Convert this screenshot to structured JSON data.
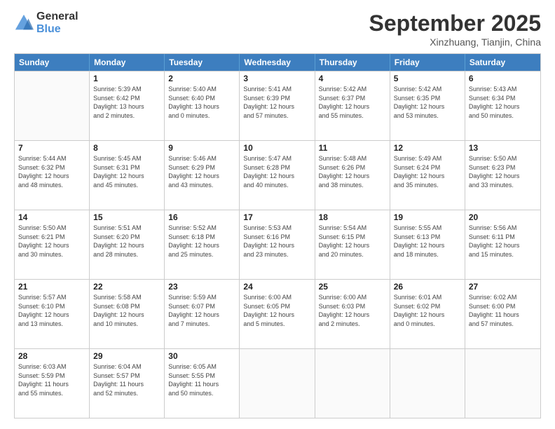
{
  "header": {
    "logo_line1": "General",
    "logo_line2": "Blue",
    "month": "September 2025",
    "location": "Xinzhuang, Tianjin, China"
  },
  "weekdays": [
    "Sunday",
    "Monday",
    "Tuesday",
    "Wednesday",
    "Thursday",
    "Friday",
    "Saturday"
  ],
  "rows": [
    [
      {
        "day": "",
        "lines": []
      },
      {
        "day": "1",
        "lines": [
          "Sunrise: 5:39 AM",
          "Sunset: 6:42 PM",
          "Daylight: 13 hours",
          "and 2 minutes."
        ]
      },
      {
        "day": "2",
        "lines": [
          "Sunrise: 5:40 AM",
          "Sunset: 6:40 PM",
          "Daylight: 13 hours",
          "and 0 minutes."
        ]
      },
      {
        "day": "3",
        "lines": [
          "Sunrise: 5:41 AM",
          "Sunset: 6:39 PM",
          "Daylight: 12 hours",
          "and 57 minutes."
        ]
      },
      {
        "day": "4",
        "lines": [
          "Sunrise: 5:42 AM",
          "Sunset: 6:37 PM",
          "Daylight: 12 hours",
          "and 55 minutes."
        ]
      },
      {
        "day": "5",
        "lines": [
          "Sunrise: 5:42 AM",
          "Sunset: 6:35 PM",
          "Daylight: 12 hours",
          "and 53 minutes."
        ]
      },
      {
        "day": "6",
        "lines": [
          "Sunrise: 5:43 AM",
          "Sunset: 6:34 PM",
          "Daylight: 12 hours",
          "and 50 minutes."
        ]
      }
    ],
    [
      {
        "day": "7",
        "lines": [
          "Sunrise: 5:44 AM",
          "Sunset: 6:32 PM",
          "Daylight: 12 hours",
          "and 48 minutes."
        ]
      },
      {
        "day": "8",
        "lines": [
          "Sunrise: 5:45 AM",
          "Sunset: 6:31 PM",
          "Daylight: 12 hours",
          "and 45 minutes."
        ]
      },
      {
        "day": "9",
        "lines": [
          "Sunrise: 5:46 AM",
          "Sunset: 6:29 PM",
          "Daylight: 12 hours",
          "and 43 minutes."
        ]
      },
      {
        "day": "10",
        "lines": [
          "Sunrise: 5:47 AM",
          "Sunset: 6:28 PM",
          "Daylight: 12 hours",
          "and 40 minutes."
        ]
      },
      {
        "day": "11",
        "lines": [
          "Sunrise: 5:48 AM",
          "Sunset: 6:26 PM",
          "Daylight: 12 hours",
          "and 38 minutes."
        ]
      },
      {
        "day": "12",
        "lines": [
          "Sunrise: 5:49 AM",
          "Sunset: 6:24 PM",
          "Daylight: 12 hours",
          "and 35 minutes."
        ]
      },
      {
        "day": "13",
        "lines": [
          "Sunrise: 5:50 AM",
          "Sunset: 6:23 PM",
          "Daylight: 12 hours",
          "and 33 minutes."
        ]
      }
    ],
    [
      {
        "day": "14",
        "lines": [
          "Sunrise: 5:50 AM",
          "Sunset: 6:21 PM",
          "Daylight: 12 hours",
          "and 30 minutes."
        ]
      },
      {
        "day": "15",
        "lines": [
          "Sunrise: 5:51 AM",
          "Sunset: 6:20 PM",
          "Daylight: 12 hours",
          "and 28 minutes."
        ]
      },
      {
        "day": "16",
        "lines": [
          "Sunrise: 5:52 AM",
          "Sunset: 6:18 PM",
          "Daylight: 12 hours",
          "and 25 minutes."
        ]
      },
      {
        "day": "17",
        "lines": [
          "Sunrise: 5:53 AM",
          "Sunset: 6:16 PM",
          "Daylight: 12 hours",
          "and 23 minutes."
        ]
      },
      {
        "day": "18",
        "lines": [
          "Sunrise: 5:54 AM",
          "Sunset: 6:15 PM",
          "Daylight: 12 hours",
          "and 20 minutes."
        ]
      },
      {
        "day": "19",
        "lines": [
          "Sunrise: 5:55 AM",
          "Sunset: 6:13 PM",
          "Daylight: 12 hours",
          "and 18 minutes."
        ]
      },
      {
        "day": "20",
        "lines": [
          "Sunrise: 5:56 AM",
          "Sunset: 6:11 PM",
          "Daylight: 12 hours",
          "and 15 minutes."
        ]
      }
    ],
    [
      {
        "day": "21",
        "lines": [
          "Sunrise: 5:57 AM",
          "Sunset: 6:10 PM",
          "Daylight: 12 hours",
          "and 13 minutes."
        ]
      },
      {
        "day": "22",
        "lines": [
          "Sunrise: 5:58 AM",
          "Sunset: 6:08 PM",
          "Daylight: 12 hours",
          "and 10 minutes."
        ]
      },
      {
        "day": "23",
        "lines": [
          "Sunrise: 5:59 AM",
          "Sunset: 6:07 PM",
          "Daylight: 12 hours",
          "and 7 minutes."
        ]
      },
      {
        "day": "24",
        "lines": [
          "Sunrise: 6:00 AM",
          "Sunset: 6:05 PM",
          "Daylight: 12 hours",
          "and 5 minutes."
        ]
      },
      {
        "day": "25",
        "lines": [
          "Sunrise: 6:00 AM",
          "Sunset: 6:03 PM",
          "Daylight: 12 hours",
          "and 2 minutes."
        ]
      },
      {
        "day": "26",
        "lines": [
          "Sunrise: 6:01 AM",
          "Sunset: 6:02 PM",
          "Daylight: 12 hours",
          "and 0 minutes."
        ]
      },
      {
        "day": "27",
        "lines": [
          "Sunrise: 6:02 AM",
          "Sunset: 6:00 PM",
          "Daylight: 11 hours",
          "and 57 minutes."
        ]
      }
    ],
    [
      {
        "day": "28",
        "lines": [
          "Sunrise: 6:03 AM",
          "Sunset: 5:59 PM",
          "Daylight: 11 hours",
          "and 55 minutes."
        ]
      },
      {
        "day": "29",
        "lines": [
          "Sunrise: 6:04 AM",
          "Sunset: 5:57 PM",
          "Daylight: 11 hours",
          "and 52 minutes."
        ]
      },
      {
        "day": "30",
        "lines": [
          "Sunrise: 6:05 AM",
          "Sunset: 5:55 PM",
          "Daylight: 11 hours",
          "and 50 minutes."
        ]
      },
      {
        "day": "",
        "lines": []
      },
      {
        "day": "",
        "lines": []
      },
      {
        "day": "",
        "lines": []
      },
      {
        "day": "",
        "lines": []
      }
    ]
  ]
}
